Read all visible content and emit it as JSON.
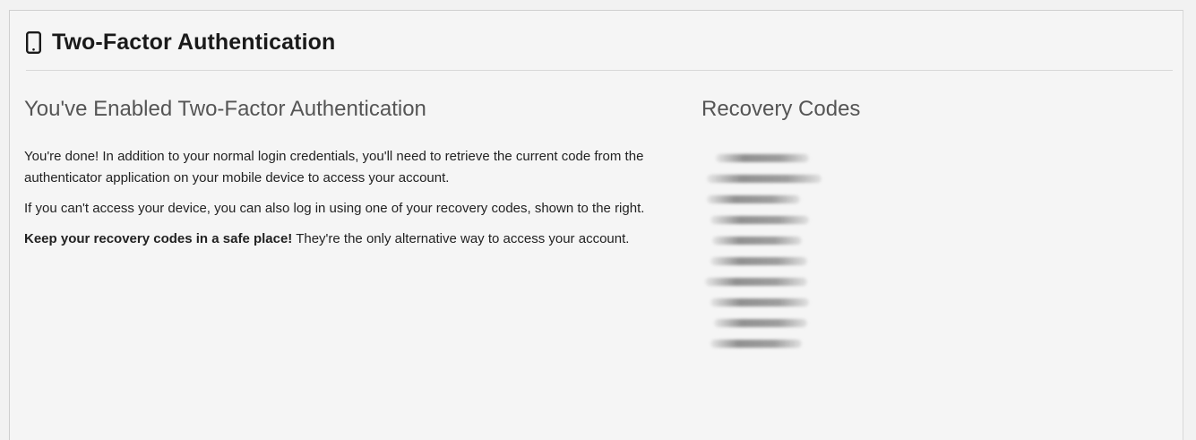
{
  "panel": {
    "title": "Two-Factor Authentication",
    "icon": "mobile-phone-icon"
  },
  "enabled_section": {
    "heading": "You've Enabled Two-Factor Authentication",
    "para1": "You're done! In addition to your normal login credentials, you'll need to retrieve the current code from the authenticator application on your mobile device to access your account.",
    "para2": "If you can't access your device, you can also log in using one of your recovery codes, shown to the right.",
    "para3_bold": "Keep your recovery codes in a safe place!",
    "para3_rest": " They're the only alternative way to access your account."
  },
  "recovery": {
    "heading": "Recovery Codes",
    "codes_obscured": true,
    "code_count": 10
  }
}
